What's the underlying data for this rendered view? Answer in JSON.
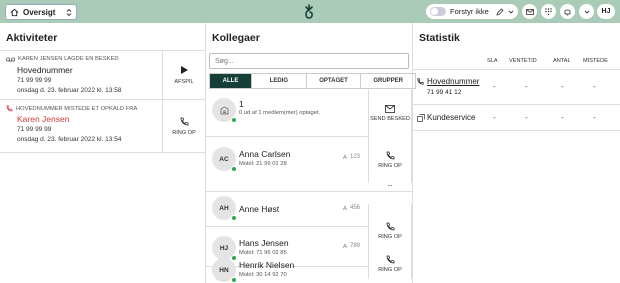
{
  "topbar": {
    "nav_label": "Oversigt",
    "toggle_label": "Forstyr ikke",
    "user_initials": "HJ"
  },
  "activities": {
    "title": "Aktiviteter",
    "items": [
      {
        "meta": "KAREN JENSEN LAGDE EN BESKED",
        "name": "Hovednummer",
        "number": "71 99 99 99",
        "date": "onsdag d. 23. februar 2022 kl. 13:58",
        "action": "AFSPIL",
        "name_color": "#222222"
      },
      {
        "meta": "HOVEDNUMMER MISTEDE ET OPKALD FRA",
        "name": "Karen Jensen",
        "number": "71 99 99 99",
        "date": "onsdag d. 23. februar 2022 kl. 13:54",
        "action": "RING OP",
        "name_color": "#d33b3b"
      }
    ]
  },
  "colleagues": {
    "title": "Kollegaer",
    "search_placeholder": "Søg...",
    "tabs": [
      "ALLE",
      "LEDIG",
      "OPTAGET",
      "GRUPPER"
    ],
    "group": {
      "count": "1",
      "sub": "0 ud af 1 medlem(mer) optaget.",
      "action": "SEND BESKED"
    },
    "people": [
      {
        "initials": "AC",
        "name": "Anna Carlsen",
        "mobile": "Mobil: 21 99 01 28",
        "ext": "123",
        "action": "RING OP"
      },
      {
        "initials": "AH",
        "name": "Anne Høst",
        "mobile": "",
        "ext": "456",
        "action": ""
      },
      {
        "initials": "HJ",
        "name": "Hans Jensen",
        "mobile": "Mobil: 71 96 02 85",
        "ext": "789",
        "action": "RING OP"
      },
      {
        "initials": "HN",
        "name": "Henrik Nielsen",
        "mobile": "Mobil: 30 14 92 70",
        "ext": "",
        "action": "RING OP"
      }
    ],
    "more": "···"
  },
  "statistics": {
    "title": "Statistik",
    "columns": [
      "SLA",
      "VENTETID",
      "ANTAL",
      "MISTEDE"
    ],
    "rows": [
      {
        "name": "Hovednummer",
        "number": "71 99 41 12",
        "values": [
          "-",
          "-",
          "-",
          "-"
        ]
      },
      {
        "name": "Kundeservice",
        "number": "",
        "values": [
          "-",
          "-",
          "-",
          "-"
        ]
      }
    ]
  },
  "colors": {
    "header_bg": "#a9cbb8",
    "accent_dark": "#173f3a",
    "online": "#2fa84f",
    "missed": "#d33b3b"
  }
}
